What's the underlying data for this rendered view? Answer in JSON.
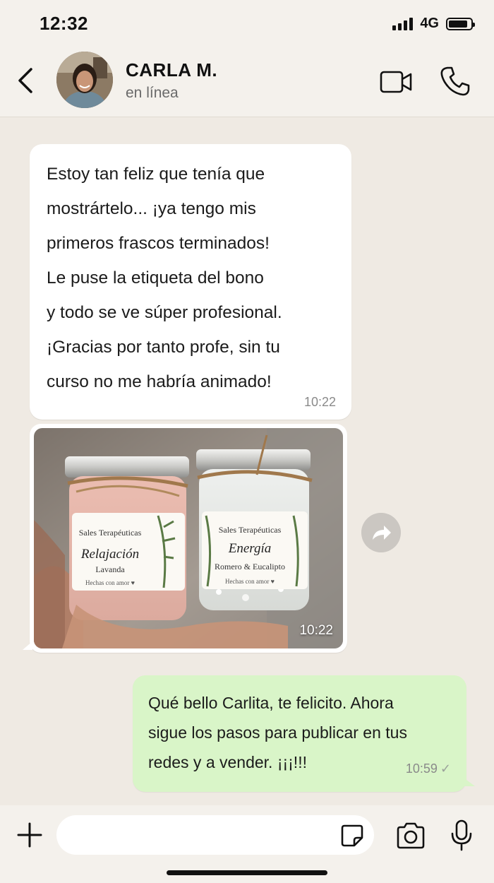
{
  "status_bar": {
    "time": "12:32",
    "network": "4G",
    "signal_icon": "signal-bars-icon",
    "battery_icon": "battery-icon"
  },
  "header": {
    "contact_name": "CARLA M.",
    "contact_status": "en línea",
    "icons": [
      "chevron-left-icon",
      "video-camera-icon",
      "phone-icon"
    ]
  },
  "messages": [
    {
      "direction": "incoming",
      "lines": [
        "Estoy tan feliz que tenía que",
        "mostrártelo... ¡ya tengo mis",
        "primeros frascos terminados!",
        "Le puse la etiqueta del bono",
        "y todo se ve súper profesional.",
        "¡Gracias por tanto profe, sin tu",
        "curso no me habría animado!"
      ],
      "time": "10:22"
    },
    {
      "direction": "incoming",
      "type": "image",
      "time": "10:22",
      "jars": [
        {
          "brand": "Sales Terapéuticas",
          "name": "Relajación",
          "subtitle": "Lavanda",
          "footer": "Hechas con amor ♥"
        },
        {
          "brand": "Sales Terapéuticas",
          "name": "Energía",
          "subtitle": "Romero & Eucalipto",
          "footer": "Hechas con amor ♥"
        }
      ]
    },
    {
      "direction": "outgoing",
      "lines": [
        "Qué bello Carlita, te felicito. Ahora",
        "sigue los pasos para publicar en tus",
        "redes y a vender. ¡¡¡!!!"
      ],
      "time": "10:59",
      "status": "✓"
    }
  ],
  "input_bar": {
    "placeholder": "",
    "icons": [
      "plus-icon",
      "sticker-icon",
      "camera-icon",
      "microphone-icon"
    ]
  },
  "colors": {
    "background": "#efeae3",
    "incoming_bubble": "#ffffff",
    "outgoing_bubble": "#d9f5c8",
    "bars": "#f4f1ec"
  }
}
